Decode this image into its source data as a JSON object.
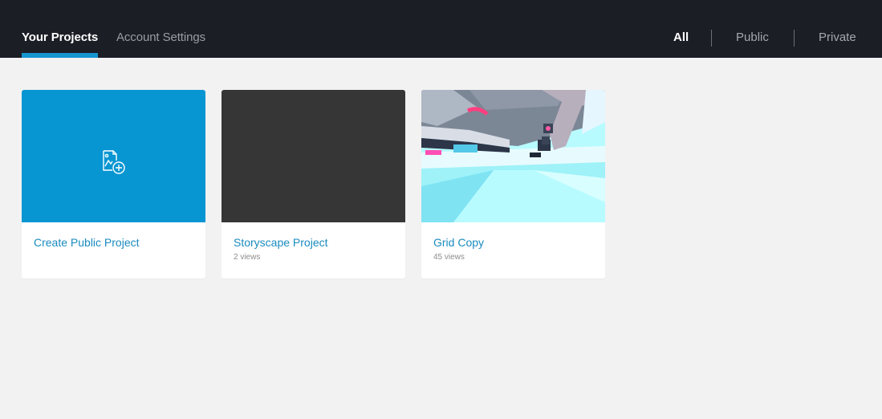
{
  "header": {
    "tabs": [
      {
        "label": "Your Projects",
        "active": true
      },
      {
        "label": "Account Settings",
        "active": false
      }
    ],
    "filters": [
      {
        "label": "All",
        "active": true
      },
      {
        "label": "Public",
        "active": false
      },
      {
        "label": "Private",
        "active": false
      }
    ]
  },
  "projects": [
    {
      "title": "Create Public Project",
      "views": "",
      "thumb_color": "#0796d2",
      "icon": "add-project-icon"
    },
    {
      "title": "Storyscape Project",
      "views": "2 views",
      "thumb_color": "#363636"
    },
    {
      "title": "Grid Copy",
      "views": "45 views",
      "thumb": "3d-scene-preview"
    }
  ],
  "colors": {
    "accent": "#1596d0",
    "topbar": "#1b1e25",
    "background": "#f2f2f2",
    "link": "#1a8bbf"
  }
}
